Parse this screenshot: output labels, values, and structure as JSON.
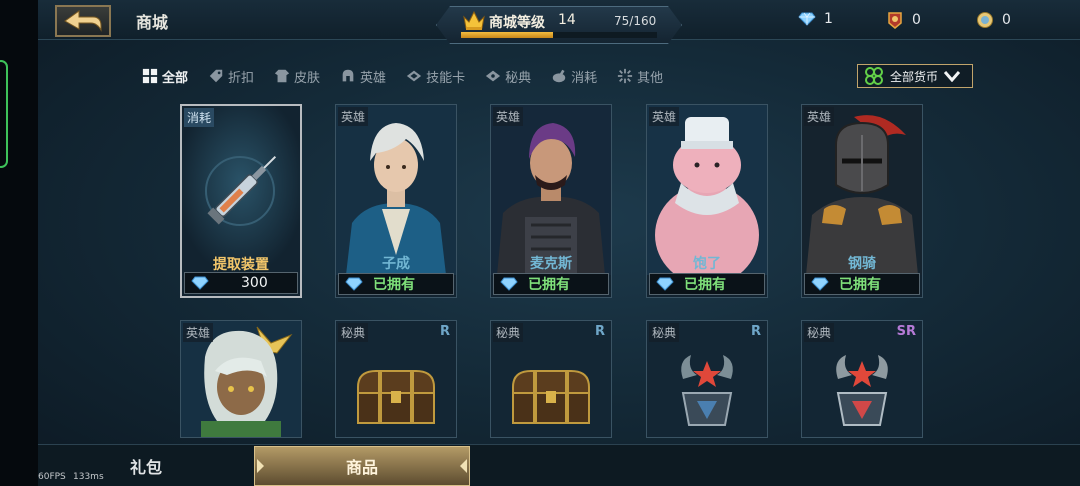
{
  "header": {
    "title": "商城",
    "level_label": "商城等级",
    "level": "14",
    "progress_text": "75/160",
    "progress_fraction": 0.47
  },
  "currencies": [
    {
      "icon": "diamond-icon",
      "value": "1"
    },
    {
      "icon": "hero-coin-icon",
      "value": "0"
    },
    {
      "icon": "gold-coin-icon",
      "value": "0"
    }
  ],
  "filters": [
    {
      "label": "全部",
      "icon": "grid-icon",
      "active": true
    },
    {
      "label": "折扣",
      "icon": "tag-icon",
      "active": false
    },
    {
      "label": "皮肤",
      "icon": "shirt-icon",
      "active": false
    },
    {
      "label": "英雄",
      "icon": "helmet-icon",
      "active": false
    },
    {
      "label": "技能卡",
      "icon": "card-icon",
      "active": false
    },
    {
      "label": "秘典",
      "icon": "book-icon",
      "active": false
    },
    {
      "label": "消耗",
      "icon": "potion-icon",
      "active": false
    },
    {
      "label": "其他",
      "icon": "sparkle-icon",
      "active": false
    }
  ],
  "currency_filter": {
    "label": "全部货币",
    "icon": "clover-icon"
  },
  "items": [
    {
      "tag": "消耗",
      "name": "提取装置",
      "price": "300",
      "status": null,
      "art": "syringe"
    },
    {
      "tag": "英雄",
      "name": "子成",
      "price": null,
      "status": "已拥有",
      "art": "hero-zicheng"
    },
    {
      "tag": "英雄",
      "name": "麦克斯",
      "price": null,
      "status": "已拥有",
      "art": "hero-max"
    },
    {
      "tag": "英雄",
      "name": "饱了",
      "price": null,
      "status": "已拥有",
      "art": "hero-chef"
    },
    {
      "tag": "英雄",
      "name": "钢骑",
      "price": null,
      "status": "已拥有",
      "art": "hero-knight"
    },
    {
      "tag": "英雄",
      "rarity": null,
      "art": "hero-girl"
    },
    {
      "tag": "秘典",
      "rarity": "R",
      "art": "chest"
    },
    {
      "tag": "秘典",
      "rarity": "R",
      "art": "chest"
    },
    {
      "tag": "秘典",
      "rarity": "R",
      "art": "altar"
    },
    {
      "tag": "秘典",
      "rarity": "SR",
      "art": "altar"
    }
  ],
  "bottom_tabs": [
    {
      "label": "礼包",
      "active": false
    },
    {
      "label": "商品",
      "active": true
    }
  ],
  "debug": {
    "fps": "60FPS",
    "ms": "133ms"
  },
  "colors": {
    "accent_gold": "#f2c66a",
    "owned_green": "#7fe07a",
    "hero_name": "#72b7d4",
    "rarity_r": "#6fa6c8",
    "rarity_sr": "#b57ad6"
  }
}
